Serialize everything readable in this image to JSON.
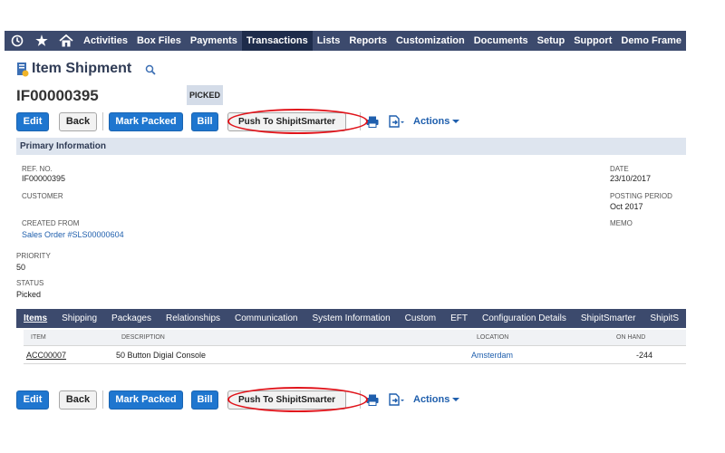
{
  "nav": {
    "items": [
      "Activities",
      "Box Files",
      "Payments",
      "Transactions",
      "Lists",
      "Reports",
      "Customization",
      "Documents",
      "Setup",
      "Support",
      "Demo Frame"
    ],
    "active": "Transactions"
  },
  "header": {
    "title": "Item Shipment",
    "record_id": "IF00000395",
    "status_badge": "PICKED"
  },
  "toolbar": {
    "edit": "Edit",
    "back": "Back",
    "mark_packed": "Mark Packed",
    "bill": "Bill",
    "push": "Push To ShipitSmarter",
    "actions": "Actions"
  },
  "primary": {
    "section_title": "Primary Information",
    "ref_no_label": "REF. NO.",
    "ref_no": "IF00000395",
    "customer_label": "CUSTOMER",
    "created_from_label": "CREATED FROM",
    "created_from": "Sales Order #SLS00000604",
    "priority_label": "PRIORITY",
    "priority": "50",
    "status_label": "STATUS",
    "status": "Picked",
    "date_label": "DATE",
    "date": "23/10/2017",
    "posting_period_label": "POSTING PERIOD",
    "posting_period": "Oct 2017",
    "memo_label": "MEMO"
  },
  "tabs": [
    "Items",
    "Shipping",
    "Packages",
    "Relationships",
    "Communication",
    "System Information",
    "Custom",
    "EFT",
    "Configuration Details",
    "ShipitSmarter",
    "ShipitS"
  ],
  "items_table": {
    "columns": [
      "ITEM",
      "DESCRIPTION",
      "LOCATION",
      "ON HAND"
    ],
    "rows": [
      {
        "item": "ACC00007",
        "description": "50 Button Digial Console",
        "location": "Amsterdam",
        "on_hand": "-244"
      }
    ]
  },
  "colors": {
    "nav_bg": "#3c4a6d",
    "button_blue": "#1f76cf",
    "highlight_red": "#e0141b"
  }
}
